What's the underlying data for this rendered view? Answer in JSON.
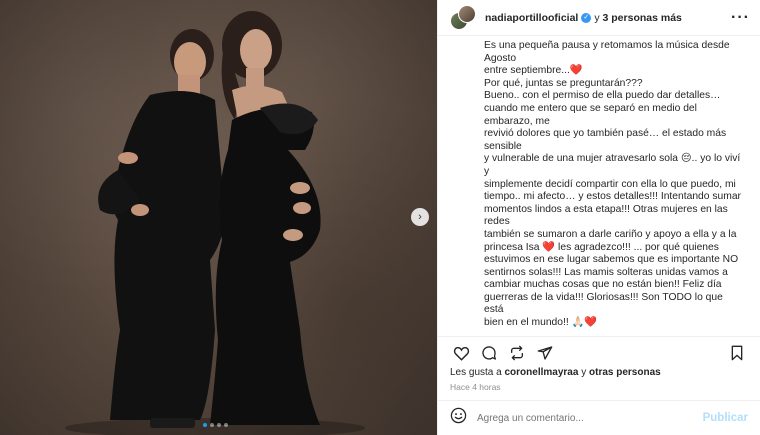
{
  "post": {
    "header": {
      "username": "nadiaportillooficial",
      "and": "y",
      "others": "3 personas más",
      "more_icon": "ellipsis-icon"
    },
    "caption": "Es una pequeña pausa y retomamos la música desde Agosto\nentre septiembre...❤️\nPor qué, juntas se preguntarán???\nBueno.. con el permiso de ella puedo dar detalles…\ncuando me entero que se separó en medio del embarazo, me\nrevivió dolores que yo también pasé… el estado más sensible\ny vulnerable de una mujer atravesarlo sola 😔.. yo lo viví y\nsimplemente decidí compartir con ella lo que puedo, mi\ntiempo.. mi afecto… y estos detalles!!! Intentando sumar\nmomentos lindos a esta etapa!!! Otras mujeres en las redes\ntambién se sumaron a darle cariño y apoyo a ella y a la\nprincesa Isa ❤️ les agradezco!!! ... por qué quienes\nestuvimos en ese lugar sabemos que es importante NO\nsentirnos solas!!! Las mamis solteras unidas vamos a\ncambiar muchas cosas que no están bien!! Feliz día\nguerreras de la vida!!! Gloriosas!!! Son TODO lo que está\nbien en el mundo!! 🙏🏻❤️\nGracias Mamá por ser él ejemplo de lucha y entrega total de\namor por los hijos!!\nTodas las mamis que lean este posteo, “sos grandiosa,\núnica, valiente y Dios está viendo todos los sacrificios que\nhaces día a día y no quedaran en vano” 🙏🏻🙏🏻🙏🏻 ❤️",
    "caption_time": "4 h",
    "likes_prefix": "Les gusta a",
    "likes_user": "coronellmayraa",
    "likes_and": "y",
    "likes_others": "otras personas",
    "posted_ago": "Hace 4 horas",
    "comment_placeholder": "Agrega un comentario...",
    "publish_label": "Publicar"
  },
  "carousel": {
    "next_label": "›",
    "total_slides": 4,
    "active_slide": 1
  },
  "colors": {
    "link_blue": "#1f9cf0",
    "publish_disabled": "#b2dffc",
    "verified": "#3897f0"
  }
}
